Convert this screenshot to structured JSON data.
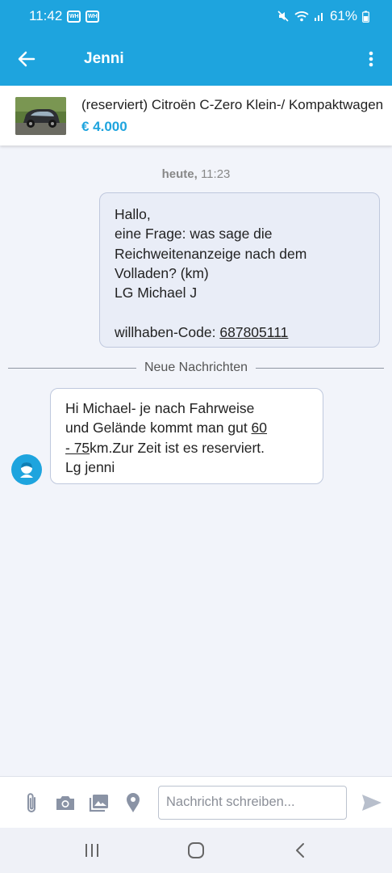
{
  "status_bar": {
    "time": "11:42",
    "badges": [
      "WH",
      "WH"
    ],
    "battery": "61%",
    "icons": [
      "mute-icon",
      "wifi-icon",
      "signal-icon",
      "battery-icon"
    ]
  },
  "app_bar": {
    "title": "Jenni",
    "back_icon": "arrow-left-icon",
    "menu_icon": "more-vertical-icon"
  },
  "listing": {
    "title": "(reserviert) Citroën C-Zero Klein-/ Kompaktwagen",
    "price": "€ 4.000"
  },
  "conversation": {
    "date_label": "heute,",
    "time": "11:23",
    "outgoing": {
      "lines": [
        "Hallo,",
        "eine Frage: was sage die",
        "Reichweitenanzeige nach dem",
        "Volladen? (km)",
        "LG Michael J"
      ],
      "code_label": "willhaben-Code:",
      "code_value": "687805111"
    },
    "divider_label": "Neue Nachrichten",
    "incoming": {
      "line1": "Hi Michael- je nach Fahrweise",
      "line2_before": "und Gelände kommt man gut ",
      "line2_link": "60",
      "line3_link": "- 75",
      "line3_after": "km.Zur Zeit ist es reserviert.",
      "line4": "Lg jenni"
    }
  },
  "composer": {
    "placeholder": "Nachricht schreiben...",
    "icons": [
      "paperclip-icon",
      "camera-icon",
      "gallery-icon",
      "location-pin-icon",
      "send-icon"
    ]
  },
  "nav_bar": {
    "icons": [
      "recent-apps-icon",
      "home-icon",
      "back-icon"
    ]
  },
  "colors": {
    "brand": "#1ea4de",
    "outgoing_bubble": "#e9edf7",
    "background": "#f2f4fa"
  }
}
